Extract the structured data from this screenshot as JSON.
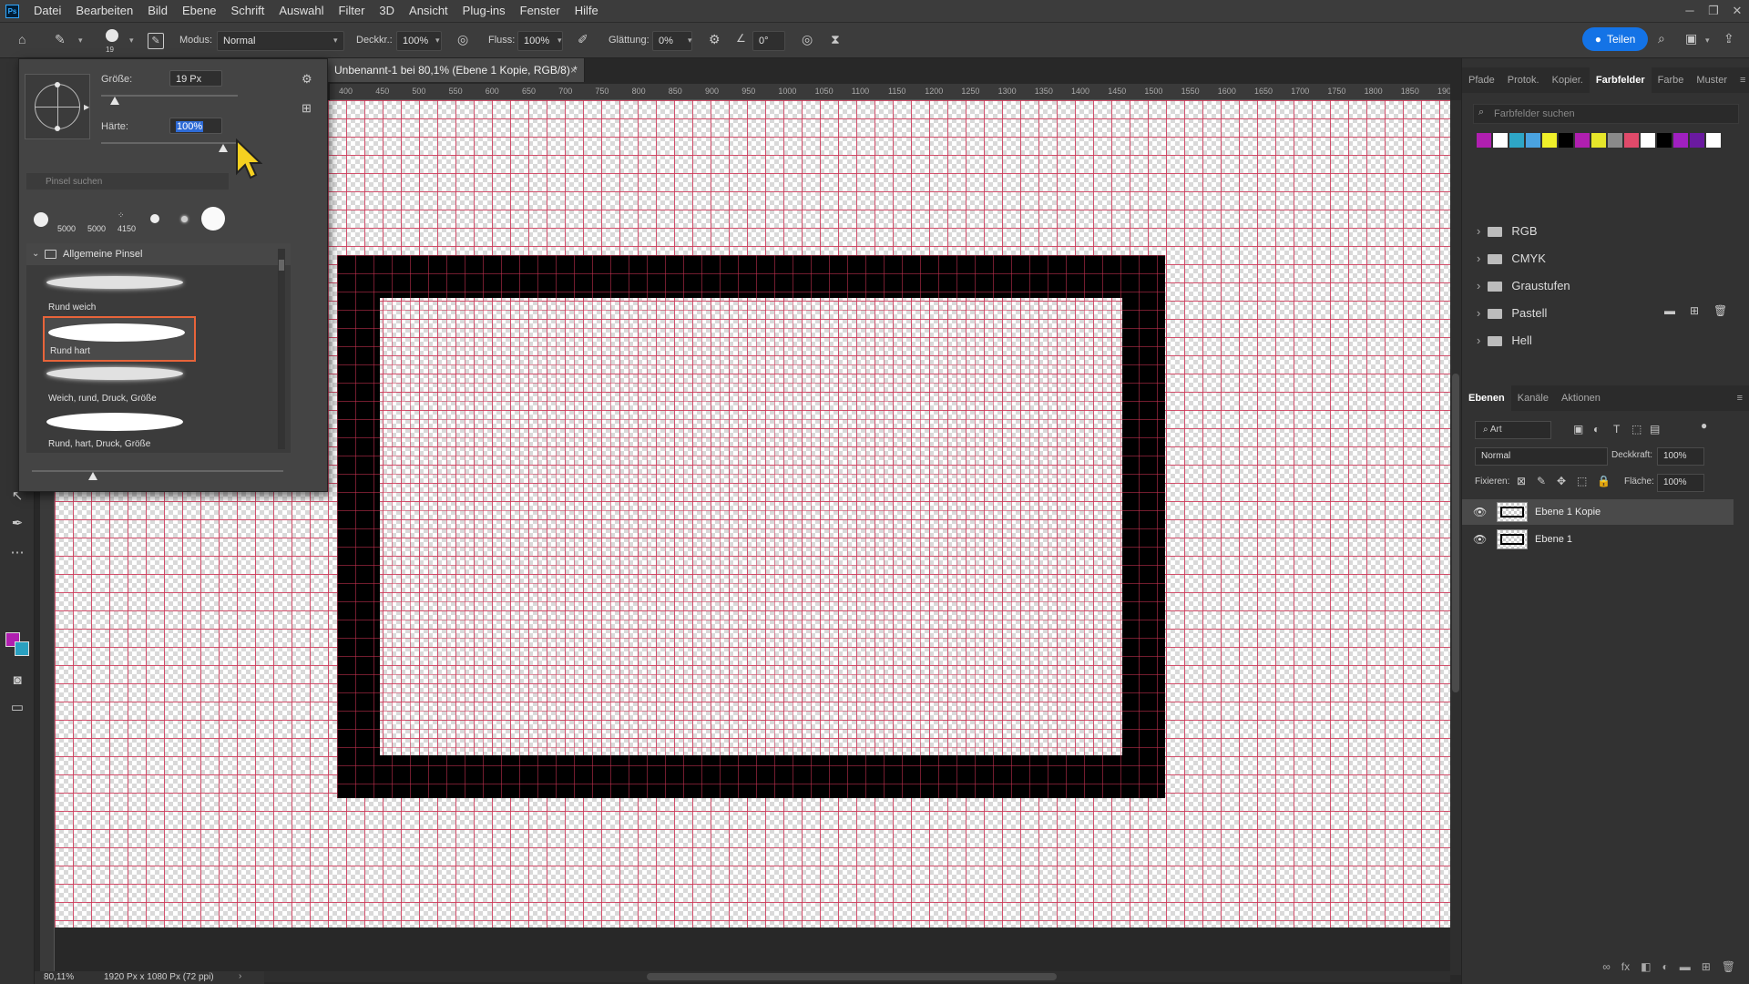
{
  "menu": [
    "Datei",
    "Bearbeiten",
    "Bild",
    "Ebene",
    "Schrift",
    "Auswahl",
    "Filter",
    "3D",
    "Ansicht",
    "Plug-ins",
    "Fenster",
    "Hilfe"
  ],
  "app_icon": "Ps",
  "options": {
    "brush_size": "19",
    "modus_label": "Modus:",
    "modus_value": "Normal",
    "deckkraft_label": "Deckkr.:",
    "deckkraft_value": "100%",
    "fluss_label": "Fluss:",
    "fluss_value": "100%",
    "glaettung_label": "Glättung:",
    "glaettung_value": "0%",
    "angle_value": "0°",
    "share_label": "Teilen"
  },
  "document": {
    "tab_title": "Unbenannt-1 bei 80,1% (Ebene 1 Kopie, RGB/8) *",
    "zoom": "80,11%",
    "size_info": "1920 Px x 1080 Px (72 ppi)"
  },
  "ruler_ticks": [
    "400",
    "450",
    "500",
    "550",
    "600",
    "650",
    "700",
    "750",
    "800",
    "850",
    "900",
    "950",
    "1000",
    "1050",
    "1100",
    "1150",
    "1200",
    "1250",
    "1300",
    "1350",
    "1400",
    "1450",
    "1500",
    "1550",
    "1600",
    "1650",
    "1700",
    "1750",
    "1800",
    "1850",
    "1900"
  ],
  "brush_panel": {
    "size_label": "Größe:",
    "size_value": "19 Px",
    "hardness_label": "Härte:",
    "hardness_value": "100%",
    "size_fraction": 0.03,
    "hardness_fraction": 1.0,
    "search_placeholder": "Pinsel suchen",
    "recent_sizes": [
      "5000",
      "5000",
      "4150"
    ],
    "folder_name": "Allgemeine Pinsel",
    "brushes": [
      "Rund weich",
      "Rund hart",
      "Weich, rund, Druck, Größe",
      "Rund, hart, Druck, Größe"
    ],
    "selected_brush": "Rund hart"
  },
  "swatches_panel": {
    "tabs": [
      "Pfade",
      "Protok.",
      "Kopier.",
      "Farbfelder",
      "Farbe",
      "Muster"
    ],
    "active_tab": "Farbfelder",
    "search_placeholder": "Farbfelder suchen",
    "colors": [
      "#b01fb0",
      "#ffffff",
      "#2ea6c6",
      "#4aa3e0",
      "#f0f02a",
      "#000000",
      "#b01fb0",
      "#e6e62a",
      "#8a8a8a",
      "#e04a6a",
      "#ffffff",
      "#000000",
      "#a020c0",
      "#6a1aa0",
      "#ffffff"
    ],
    "groups": [
      "RGB",
      "CMYK",
      "Graustufen",
      "Pastell",
      "Hell"
    ]
  },
  "layers_panel": {
    "tabs": [
      "Ebenen",
      "Kanäle",
      "Aktionen"
    ],
    "active_tab": "Ebenen",
    "filter_label": "Art",
    "blend_mode": "Normal",
    "opacity_label": "Deckkraft:",
    "opacity_value": "100%",
    "lock_label": "Fixieren:",
    "fill_label": "Fläche:",
    "fill_value": "100%",
    "layers": [
      "Ebene 1 Kopie",
      "Ebene 1"
    ],
    "selected_layer": "Ebene 1 Kopie"
  },
  "colors": {
    "foreground": "#b01fb0",
    "background": "#2aa0c0",
    "accent": "#1473e6",
    "grid": "#ce3454"
  }
}
